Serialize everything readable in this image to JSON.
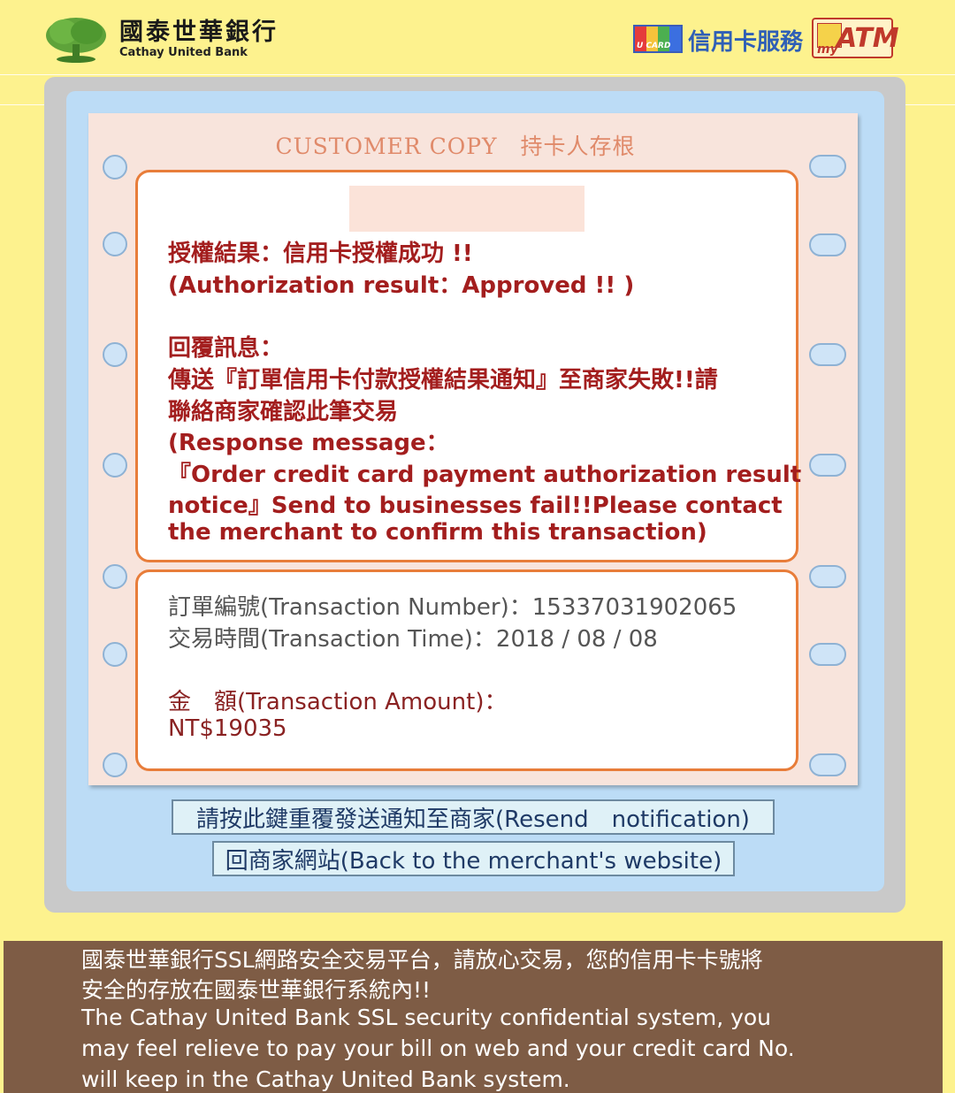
{
  "header": {
    "bank_name_zh": "國泰世華銀行",
    "bank_name_en": "Cathay United Bank",
    "ucard_logo_text": "U CARD",
    "credit_card_service": "信用卡服務",
    "atm_logo_text": "ATM",
    "atm_logo_prefix": "my"
  },
  "receipt": {
    "copy_title": "CUSTOMER COPY　持卡人存根",
    "auth_result_zh": "授權結果：信用卡授權成功 !!",
    "auth_result_en": "(Authorization result：Approved !! )",
    "response_label_zh": "回覆訊息：",
    "response_line1_zh": "傳送『訂單信用卡付款授權結果通知』至商家失敗!!請",
    "response_line2_zh": "聯絡商家確認此筆交易",
    "response_label_en": "(Response message：",
    "response_line1_en": "『Order credit card payment authorization result",
    "response_line2_en": "notice』Send to businesses fail!!Please contact",
    "response_line3_en": "the merchant to confirm this transaction)",
    "transaction_number": "訂單編號(Transaction Number)：15337031902065",
    "transaction_time": "交易時間(Transaction Time)：2018 / 08 / 08",
    "amount_label": "金　額(Transaction Amount)：",
    "amount_value": "NT$19035"
  },
  "buttons": {
    "resend": "請按此鍵重覆發送通知至商家(Resend　notification)",
    "back": "回商家網站(Back to the merchant's website)"
  },
  "footer": {
    "line1_zh": "國泰世華銀行SSL網路安全交易平台，請放心交易，您的信用卡卡號將",
    "line2_zh": "安全的存放在國泰世華銀行系統內!!",
    "line1_en": "The Cathay United Bank SSL security confidential system, you",
    "line2_en": "may feel relieve to pay your bill on web and your credit card No.",
    "line3_en": "will keep in the Cathay United Bank system."
  },
  "colors": {
    "page_background": "#fdf28e",
    "receipt_border": "#e87d3a",
    "message_red": "#a31e1e",
    "footer_brown": "#7e5c45"
  }
}
